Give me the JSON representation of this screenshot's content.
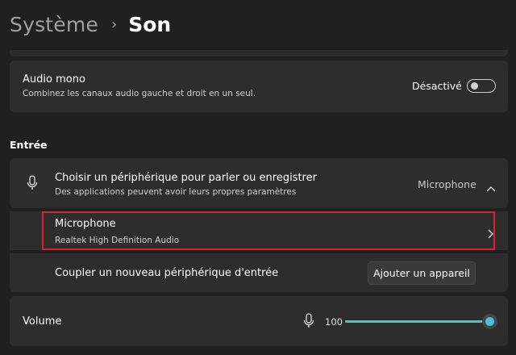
{
  "breadcrumb": {
    "parent": "Système",
    "separator": "›",
    "current": "Son"
  },
  "mono": {
    "title": "Audio mono",
    "description": "Combinez les canaux audio gauche et droit en un seul.",
    "toggle_label": "Désactivé",
    "enabled": false
  },
  "input_section": {
    "title": "Entrée"
  },
  "device_choice": {
    "title": "Choisir un périphérique pour parler ou enregistrer",
    "description": "Des applications peuvent avoir leurs propres paramètres",
    "value": "Microphone",
    "icon": "microphone-icon",
    "expand_icon": "chevron-up-icon"
  },
  "microphone_device": {
    "title": "Microphone",
    "subtitle": "Realtek High Definition Audio",
    "icon": "chevron-right-icon"
  },
  "pair_device": {
    "title": "Coupler un nouveau périphérique d'entrée",
    "button_label": "Ajouter un appareil"
  },
  "volume": {
    "label": "Volume",
    "value": "100",
    "level": 1.0,
    "icon": "microphone-icon",
    "accent_color": "#4cc2d4"
  },
  "colors": {
    "background": "#202020",
    "card": "#2d2d2d",
    "highlight": "#e0202c"
  }
}
